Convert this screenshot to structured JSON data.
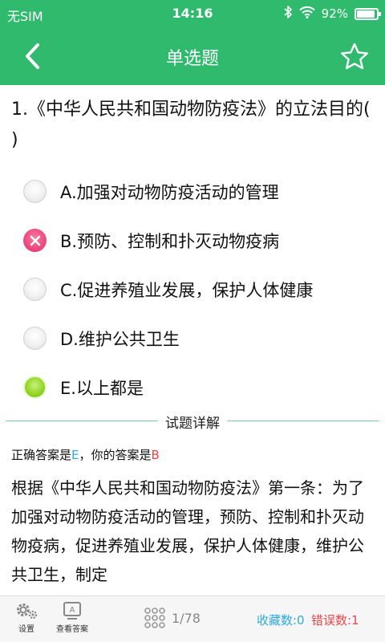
{
  "status_bar": {
    "carrier": "无SIM",
    "time": "14:16",
    "battery": "92%",
    "battery_level": 0.92,
    "icons": [
      "bluetooth-icon",
      "wifi-icon",
      "battery-icon"
    ]
  },
  "nav": {
    "title": "单选题",
    "back_icon": "chevron-left-icon",
    "favorite_icon": "star-outline-icon"
  },
  "question": {
    "text": "1.《中华人民共和国动物防疫法》的立法目的( )"
  },
  "options": [
    {
      "text": "A.加强对动物防疫活动的管理",
      "state": "unselected"
    },
    {
      "text": "B.预防、控制和扑灭动物疫病",
      "state": "selected-wrong"
    },
    {
      "text": "C.促进养殖业发展，保护人体健康",
      "state": "unselected"
    },
    {
      "text": "D.维护公共卫生",
      "state": "unselected"
    },
    {
      "text": "E.以上都是",
      "state": "correct"
    }
  ],
  "detail": {
    "section_title": "试题详解",
    "correct_prefix": "正确答案是",
    "correct_answer": "E",
    "your_prefix": "，你的答案是",
    "your_answer": "B",
    "explanation": "根据《中华人民共和国动物防疫法》第一条：为了加强对动物防疫活动的管理，预防、控制和扑灭动物疫病，促进养殖业发展，保护人体健康，维护公共卫生，制定"
  },
  "bottom_bar": {
    "settings_label": "设置",
    "view_answer_label": "查看答案",
    "page": "1/78",
    "favorites": "收藏数:0",
    "errors": "错误数:1"
  },
  "colors": {
    "accent": "#2fba6d",
    "correct": "#2ea9df",
    "wrong": "#e8474a"
  }
}
